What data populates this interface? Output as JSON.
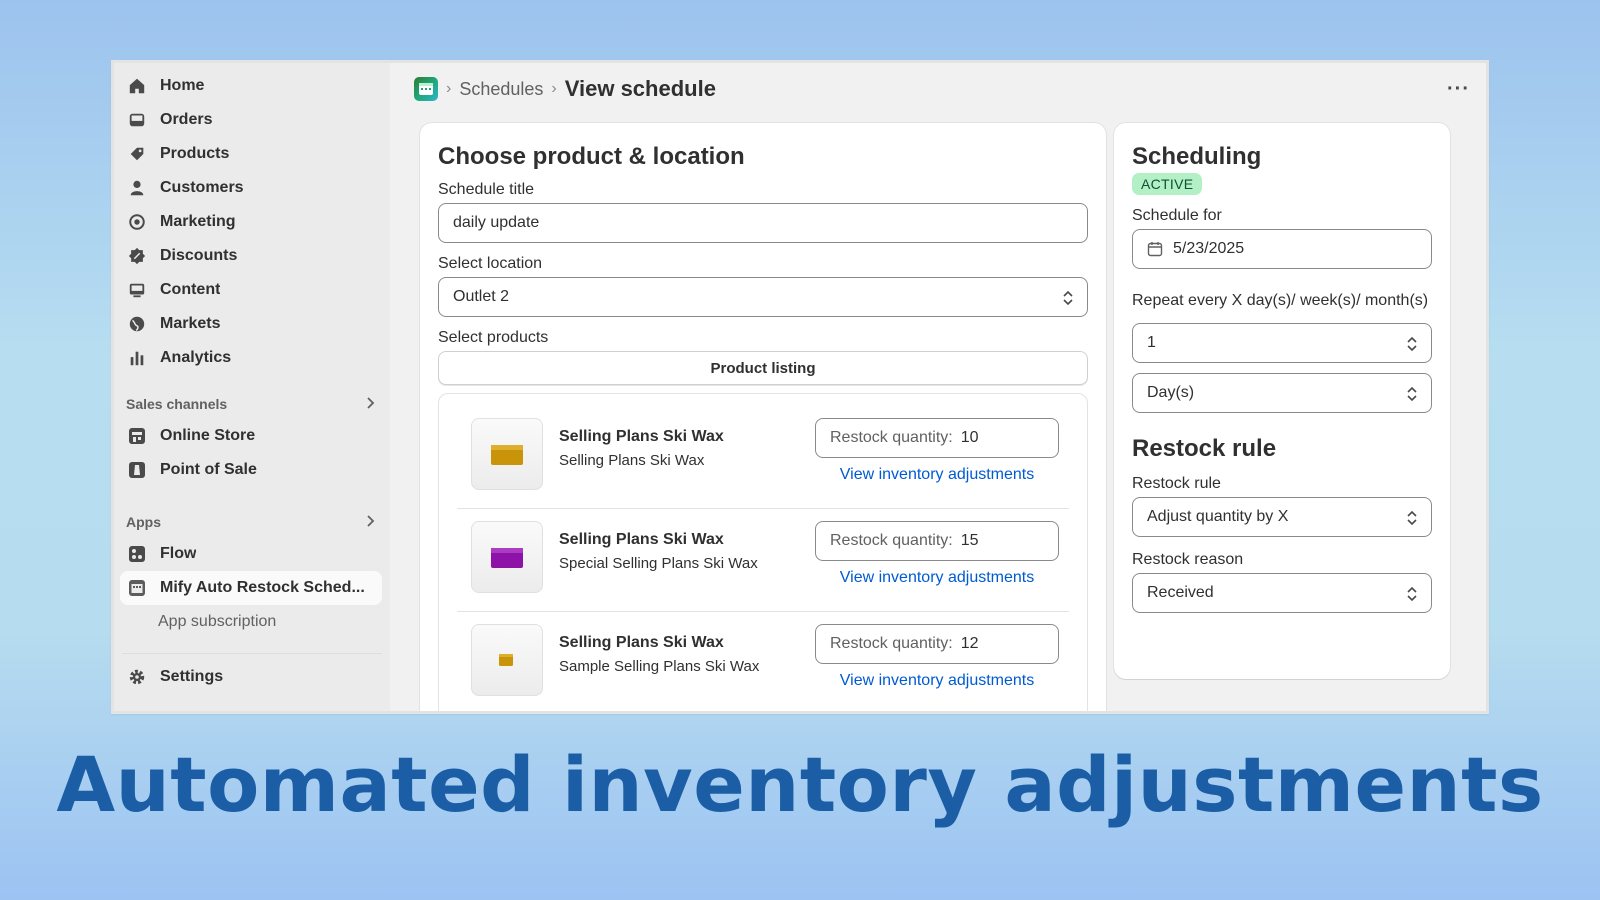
{
  "sidebar": {
    "items": [
      {
        "label": "Home",
        "icon": "home-icon"
      },
      {
        "label": "Orders",
        "icon": "inbox-icon"
      },
      {
        "label": "Products",
        "icon": "tag-icon"
      },
      {
        "label": "Customers",
        "icon": "person-icon"
      },
      {
        "label": "Marketing",
        "icon": "target-icon"
      },
      {
        "label": "Discounts",
        "icon": "discount-icon"
      },
      {
        "label": "Content",
        "icon": "content-icon"
      },
      {
        "label": "Markets",
        "icon": "globe-icon"
      },
      {
        "label": "Analytics",
        "icon": "bar-chart-icon"
      }
    ],
    "sales_channels": {
      "heading": "Sales channels",
      "items": [
        {
          "label": "Online Store",
          "icon": "store-icon"
        },
        {
          "label": "Point of Sale",
          "icon": "pos-icon"
        }
      ]
    },
    "apps": {
      "heading": "Apps",
      "items": [
        {
          "label": "Flow",
          "icon": "flow-icon"
        },
        {
          "label": "Mify Auto Restock Sched...",
          "icon": "app-calendar-icon"
        }
      ],
      "subitem": "App subscription"
    },
    "settings": {
      "label": "Settings",
      "icon": "gear-icon"
    }
  },
  "breadcrumb": {
    "parent": "Schedules",
    "current": "View schedule",
    "more": "···"
  },
  "product_card": {
    "title": "Choose product & location",
    "schedule_title_label": "Schedule title",
    "schedule_title_value": "daily update",
    "location_label": "Select location",
    "location_value": "Outlet 2",
    "products_label": "Select products",
    "listing_button": "Product listing",
    "restock_prefix": "Restock quantity:",
    "link_label": "View inventory adjustments",
    "products": [
      {
        "title": "Selling Plans Ski Wax",
        "variant": "Selling Plans Ski Wax",
        "quantity": "10",
        "color": "#c9930a"
      },
      {
        "title": "Selling Plans Ski Wax",
        "variant": "Special Selling Plans Ski Wax",
        "quantity": "15",
        "color": "#8e12a8"
      },
      {
        "title": "Selling Plans Ski Wax",
        "variant": "Sample Selling Plans Ski Wax",
        "quantity": "12",
        "color": "#c9930a"
      }
    ]
  },
  "scheduling": {
    "title": "Scheduling",
    "status": "ACTIVE",
    "schedule_for_label": "Schedule for",
    "date": "5/23/2025",
    "repeat_label": "Repeat every X day(s)/ week(s)/ month(s)",
    "repeat_value": "1",
    "unit_value": "Day(s)",
    "restock_title": "Restock rule",
    "restock_rule_label": "Restock rule",
    "restock_rule_value": "Adjust quantity by X",
    "restock_reason_label": "Restock reason",
    "restock_reason_value": "Received"
  },
  "headline": "Automated inventory adjustments",
  "colors": {
    "link": "#005bd3",
    "badge_bg": "#b3f0c6",
    "headline": "#1b5ea6"
  }
}
